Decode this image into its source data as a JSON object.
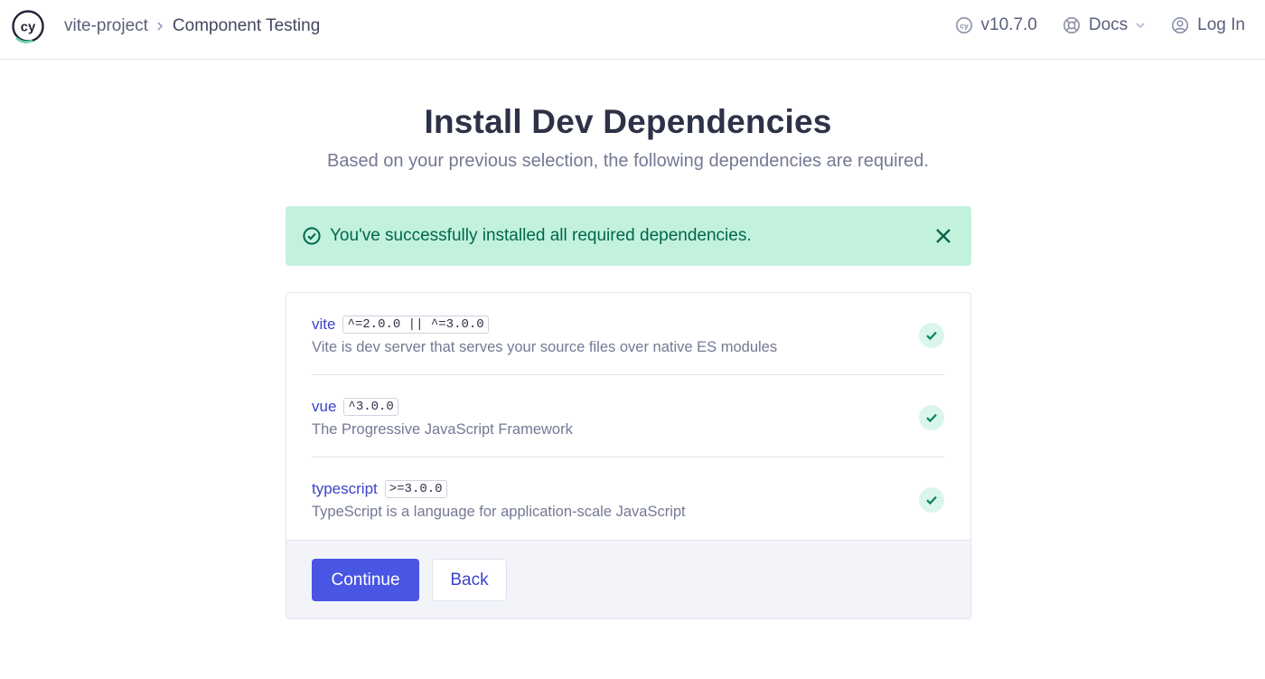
{
  "header": {
    "project": "vite-project",
    "current": "Component Testing",
    "version": "v10.7.0",
    "docs_label": "Docs",
    "login_label": "Log In"
  },
  "main": {
    "title": "Install Dev Dependencies",
    "subtitle": "Based on your previous selection, the following dependencies are required."
  },
  "alert": {
    "message": "You've successfully installed all required dependencies.",
    "status": "success"
  },
  "dependencies": [
    {
      "name": "vite",
      "version": "^=2.0.0 || ^=3.0.0",
      "description": "Vite is dev server that serves your source files over native ES modules",
      "installed": true
    },
    {
      "name": "vue",
      "version": "^3.0.0",
      "description": "The Progressive JavaScript Framework",
      "installed": true
    },
    {
      "name": "typescript",
      "version": ">=3.0.0",
      "description": "TypeScript is a language for application-scale JavaScript",
      "installed": true
    }
  ],
  "actions": {
    "continue_label": "Continue",
    "back_label": "Back"
  },
  "colors": {
    "primary": "#4956e3",
    "success_bg": "#c2f1de",
    "success_text": "#00674b",
    "link": "#3a44c9"
  }
}
